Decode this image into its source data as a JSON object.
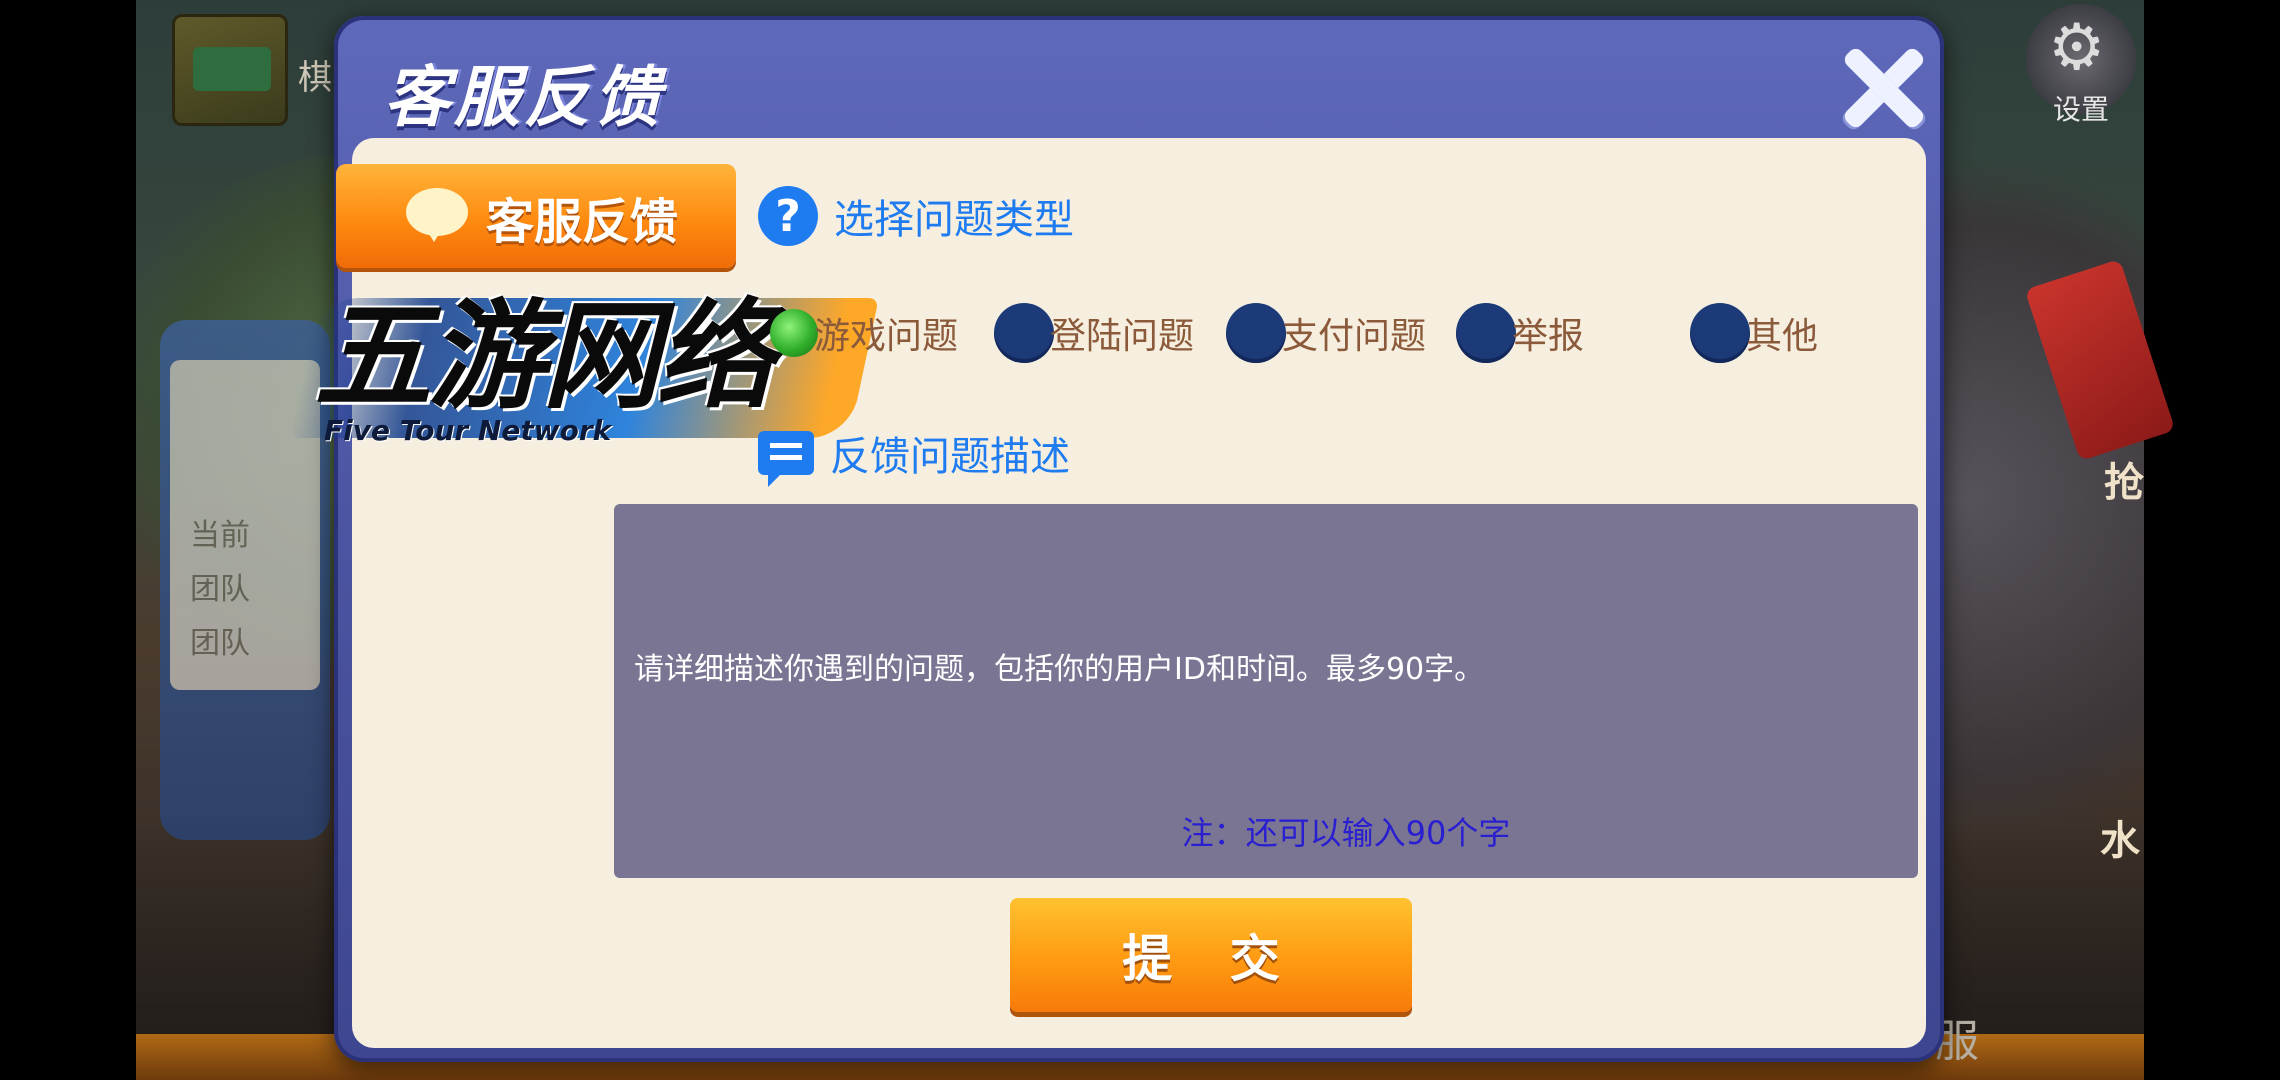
{
  "background": {
    "mode_label": "棋",
    "settings_label": "设置",
    "left_panel_lines": [
      "当前",
      "团队",
      "团队"
    ],
    "right_texts": [
      "抢",
      "水"
    ],
    "bottom_right_text": "服"
  },
  "modal": {
    "title": "客服反馈",
    "tab_label": "客服反馈",
    "watermark": {
      "main": "五游网络",
      "sub": "Five Tour Network"
    },
    "problem_type": {
      "title": "选择问题类型",
      "options": [
        {
          "label": "游戏问题",
          "selected": true
        },
        {
          "label": "登陆问题",
          "selected": false
        },
        {
          "label": "支付问题",
          "selected": false
        },
        {
          "label": "举报",
          "selected": false
        },
        {
          "label": "其他",
          "selected": false
        }
      ]
    },
    "description": {
      "title": "反馈问题描述",
      "placeholder": "请详细描述你遇到的问题，包括你的用户ID和时间。最多90字。",
      "note": "注：还可以输入90个字"
    },
    "submit_label": "提 交"
  },
  "colors": {
    "accent_blue": "#1e7cf0",
    "submit_orange": "#ff9a12",
    "modal_purple": "#5f69bb",
    "content_cream": "#f6eedf"
  }
}
